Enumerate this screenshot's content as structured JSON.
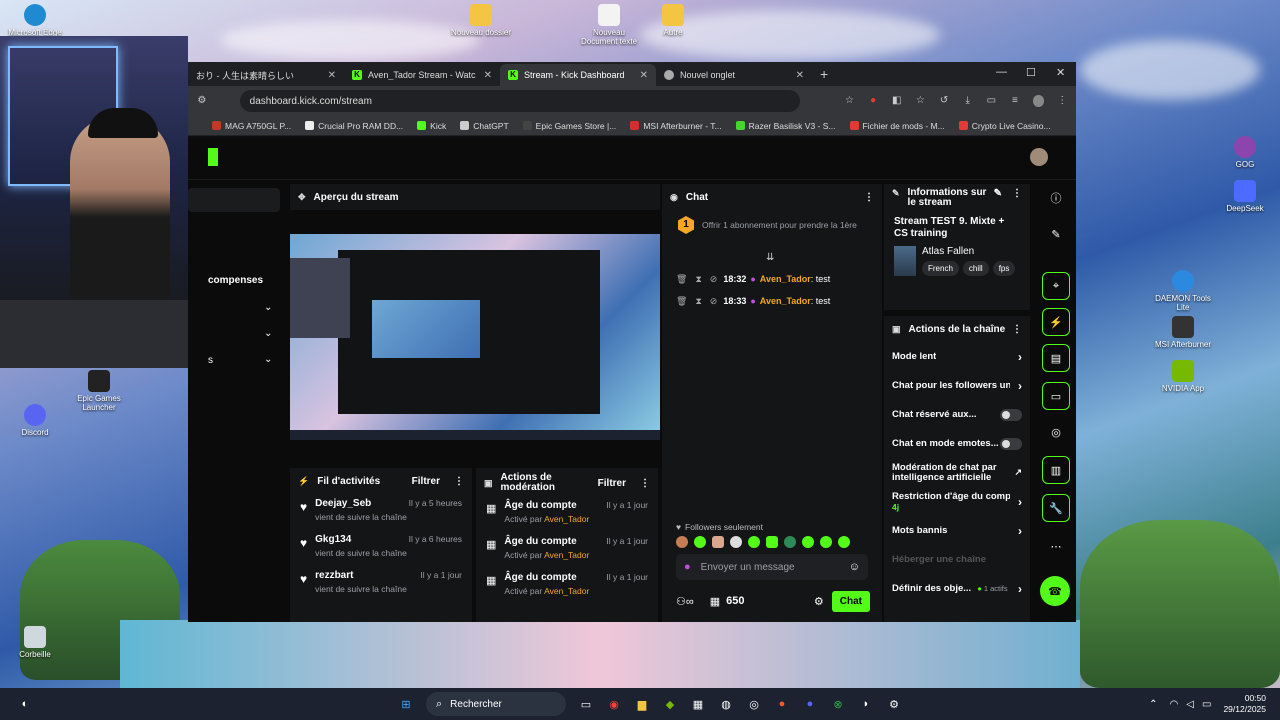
{
  "desktop": {
    "icons": [
      {
        "label": "Microsoft Edge"
      },
      {
        "label": "Nouveau dossier"
      },
      {
        "label": "Nouveau Document texte"
      },
      {
        "label": "Autre"
      },
      {
        "label": "Epic Games Launcher"
      },
      {
        "label": "Discord"
      },
      {
        "label": "Corbeille"
      },
      {
        "label": "DAEMON Tools Lite"
      },
      {
        "label": "MSI Afterburner"
      },
      {
        "label": "NVIDIA App"
      },
      {
        "label": "DeepSeek"
      },
      {
        "label": "GOG"
      }
    ]
  },
  "browser": {
    "tabs": [
      {
        "label": "おり - 人生は素晴らしい"
      },
      {
        "label": "Aven_Tador Stream - Watch Live"
      },
      {
        "label": "Stream - Kick Dashboard"
      },
      {
        "label": "Nouvel onglet"
      }
    ],
    "url": "dashboard.kick.com/stream",
    "bookmarks": [
      {
        "label": "MAG A750GL P...",
        "color": "#c0392b"
      },
      {
        "label": "Crucial Pro RAM DD...",
        "color": "#eeeeee"
      },
      {
        "label": "Kick",
        "color": "#53fc18"
      },
      {
        "label": "ChatGPT",
        "color": "#cccccc"
      },
      {
        "label": "Epic Games Store |...",
        "color": "#444444"
      },
      {
        "label": "MSI Afterburner - T...",
        "color": "#d32f2f"
      },
      {
        "label": "Razer Basilisk V3 - S...",
        "color": "#44d62c"
      },
      {
        "label": "Fichier de mods - M...",
        "color": "#e53935"
      },
      {
        "label": "Crypto Live Casino...",
        "color": "#e53935"
      }
    ]
  },
  "sidebar": {
    "item_label": "compenses",
    "item3_label": "s"
  },
  "preview": {
    "title": "Aperçu du stream"
  },
  "activity": {
    "title": "Fil d'activités",
    "filter": "Filtrer",
    "items": [
      {
        "name": "Deejay_Seb",
        "time": "Il y a 5 heures",
        "desc": "vient de suivre la chaîne"
      },
      {
        "name": "Gkg134",
        "time": "Il y a 6 heures",
        "desc": "vient de suivre la chaîne"
      },
      {
        "name": "rezzbart",
        "time": "Il y a 1 jour",
        "desc": "vient de suivre la chaîne"
      }
    ]
  },
  "moderation": {
    "title": "Actions de modération",
    "filter": "Filtrer",
    "items": [
      {
        "action": "Âge du compte",
        "time": "Il y a 1 jour",
        "by_prefix": "Activé par",
        "by": "Aven_Tador"
      },
      {
        "action": "Âge du compte",
        "time": "Il y a 1 jour",
        "by_prefix": "Activé par",
        "by": "Aven_Tador"
      },
      {
        "action": "Âge du compte",
        "time": "Il y a 1 jour",
        "by_prefix": "Activé par",
        "by": "Aven_Tador"
      }
    ]
  },
  "chat": {
    "title": "Chat",
    "sub_badge": "1",
    "sub_offer": "Offrir 1 abonnement pour prendre la 1ère",
    "messages": [
      {
        "time": "18:32",
        "user": "Aven_Tador",
        "text": ": test"
      },
      {
        "time": "18:33",
        "user": "Aven_Tador",
        "text": ": test"
      }
    ],
    "followers_only": "Followers seulement",
    "placeholder": "Envoyer un message",
    "points": "650",
    "send": "Chat"
  },
  "info": {
    "title": "Informations sur le stream",
    "stream_title": "Stream TEST 9. Mixte + CS training",
    "game": "Atlas Fallen",
    "tags": [
      "French",
      "chill",
      "fps"
    ]
  },
  "channel_actions": {
    "title": "Actions de la chaîne",
    "items": [
      {
        "label": "Mode lent",
        "control": "chevron"
      },
      {
        "label": "Chat pour les followers un",
        "control": "chevron"
      },
      {
        "label": "Chat réservé aux...",
        "control": "toggle"
      },
      {
        "label": "Chat en mode emotes...",
        "control": "toggle"
      },
      {
        "label": "Modération de chat par intelligence artificielle",
        "control": "external"
      },
      {
        "label": "Restriction d'âge du comp",
        "sub": "4j",
        "control": "chevron"
      },
      {
        "label": "Mots bannis",
        "control": "chevron"
      },
      {
        "label": "Héberger une chaîne",
        "control": "none",
        "disabled": true
      },
      {
        "label": "Définir des obje...",
        "badge": "1 actifs",
        "control": "chevron"
      }
    ]
  },
  "taskbar": {
    "search": "Rechercher",
    "time": "00:50",
    "date": "29/12/2025"
  },
  "colors": {
    "kick_green": "#53fc18",
    "username_orange": "#f5a623",
    "panel": "#141517",
    "page_bg": "#0b0b0c"
  }
}
